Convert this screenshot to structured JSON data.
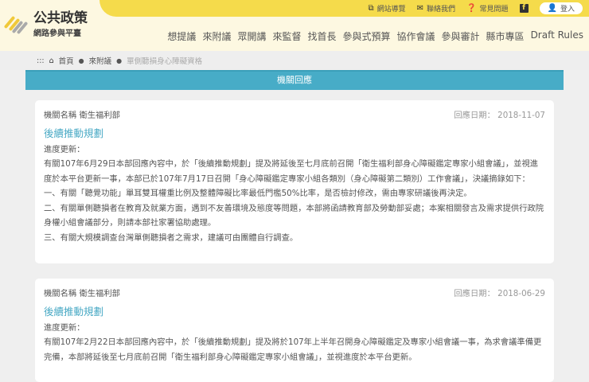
{
  "site": {
    "title": "公共政策",
    "subtitle": "網路參與平臺"
  },
  "topbar": [
    {
      "icon": "sitemap-icon",
      "label": "網站導覽"
    },
    {
      "icon": "mail-icon",
      "label": "聯絡我們"
    },
    {
      "icon": "question-icon",
      "label": "常見問題"
    }
  ],
  "facebook_icon": "f",
  "login_label": "登入",
  "nav": [
    "想提議",
    "來附議",
    "眾開講",
    "來監督",
    "找首長",
    "參與式預算",
    "協作會議",
    "參與審計",
    "縣市專區",
    "Draft Rules"
  ],
  "breadcrumb": {
    "home": "首頁",
    "level1": "來附議",
    "current": "單側聽損身心障礙資格"
  },
  "panel_title": "機關回應",
  "responses": [
    {
      "agency": "機關名稱  衛生福利部",
      "date": "回應日期： 2018-11-07",
      "subtitle": "後續推動規劃",
      "progress": "進度更新：",
      "paragraphs": [
        "有關107年6月29日本部回應內容中，於「後續推動規劃」提及將延後至七月底前召開「衛生福利部身心障礙鑑定專家小組會議」，並視進度於本平台更新一事，本部已於107年7月17日召開「身心障礙鑑定專家小組各類別（身心障礙第二類別）工作會議」，決議摘錄如下：",
        "一、有關「聽覺功能」單耳雙耳權重比例及整體障礙比率最低門檻50%比率，是否檢討修改，需由專家研議後再決定。",
        "二、有關單側聽損者在教育及就業方面，遇到不友善環境及態度等問題，本部將函請教育部及勞動部妥處；本案相關發言及需求提供行政院身權小組會議部分，則請本部社家署協助處理。",
        "三、有關大規模調查台灣單側聽損者之需求，建議可由團體自行調查。"
      ]
    },
    {
      "agency": "機關名稱  衛生福利部",
      "date": "回應日期： 2018-06-29",
      "subtitle": "後續推動規劃",
      "progress": "進度更新：",
      "paragraphs": [
        "有關107年2月22日本部回應內容中，於「後續推動規劃」提及將於107年上半年召開身心障礙鑑定及專家小組會議一事，為求會議準備更完備，本部將延後至七月底前召開「衛生福利部身心障礙鑑定專家小組會議」，並視進度於本平台更新。"
      ]
    }
  ]
}
